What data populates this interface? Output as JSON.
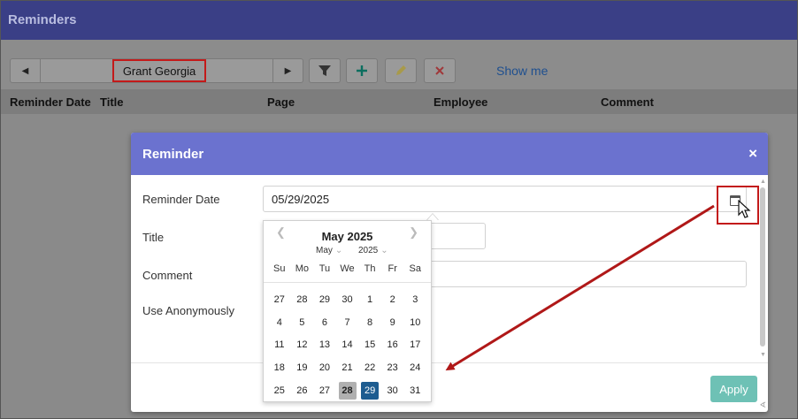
{
  "app": {
    "title": "Reminders"
  },
  "toolbar": {
    "prev_icon": "triangle-left-icon",
    "next_icon": "triangle-right-icon",
    "employee_name": "Grant Georgia",
    "filter_icon": "filter-icon",
    "add_icon": "plus-icon",
    "edit_icon": "pencil-icon",
    "delete_icon": "x-icon",
    "show_me": "Show me"
  },
  "grid": {
    "columns": [
      "Reminder Date",
      "Title",
      "Page",
      "Employee",
      "Comment"
    ]
  },
  "dialog": {
    "title": "Reminder",
    "close": "×",
    "labels": {
      "reminder_date": "Reminder Date",
      "title": "Title",
      "comment": "Comment",
      "anonymous": "Use Anonymously"
    },
    "reminder_date_value": "05/29/2025",
    "apply": "Apply"
  },
  "calendar": {
    "header": "May 2025",
    "month_select": "May",
    "year_select": "2025",
    "days_of_week": [
      "Su",
      "Mo",
      "Tu",
      "We",
      "Th",
      "Fr",
      "Sa"
    ],
    "weeks": [
      [
        "27",
        "28",
        "29",
        "30",
        "1",
        "2",
        "3"
      ],
      [
        "4",
        "5",
        "6",
        "7",
        "8",
        "9",
        "10"
      ],
      [
        "11",
        "12",
        "13",
        "14",
        "15",
        "16",
        "17"
      ],
      [
        "18",
        "19",
        "20",
        "21",
        "22",
        "23",
        "24"
      ],
      [
        "25",
        "26",
        "27",
        "28",
        "29",
        "30",
        "31"
      ]
    ],
    "today": "28",
    "selected": "29"
  },
  "colors": {
    "titlebar": "#3a3f86",
    "dialog_header": "#6b72cf",
    "selected_day": "#1d5c90",
    "apply_button": "#6ec1b5",
    "annotation": "#c31a1a"
  }
}
